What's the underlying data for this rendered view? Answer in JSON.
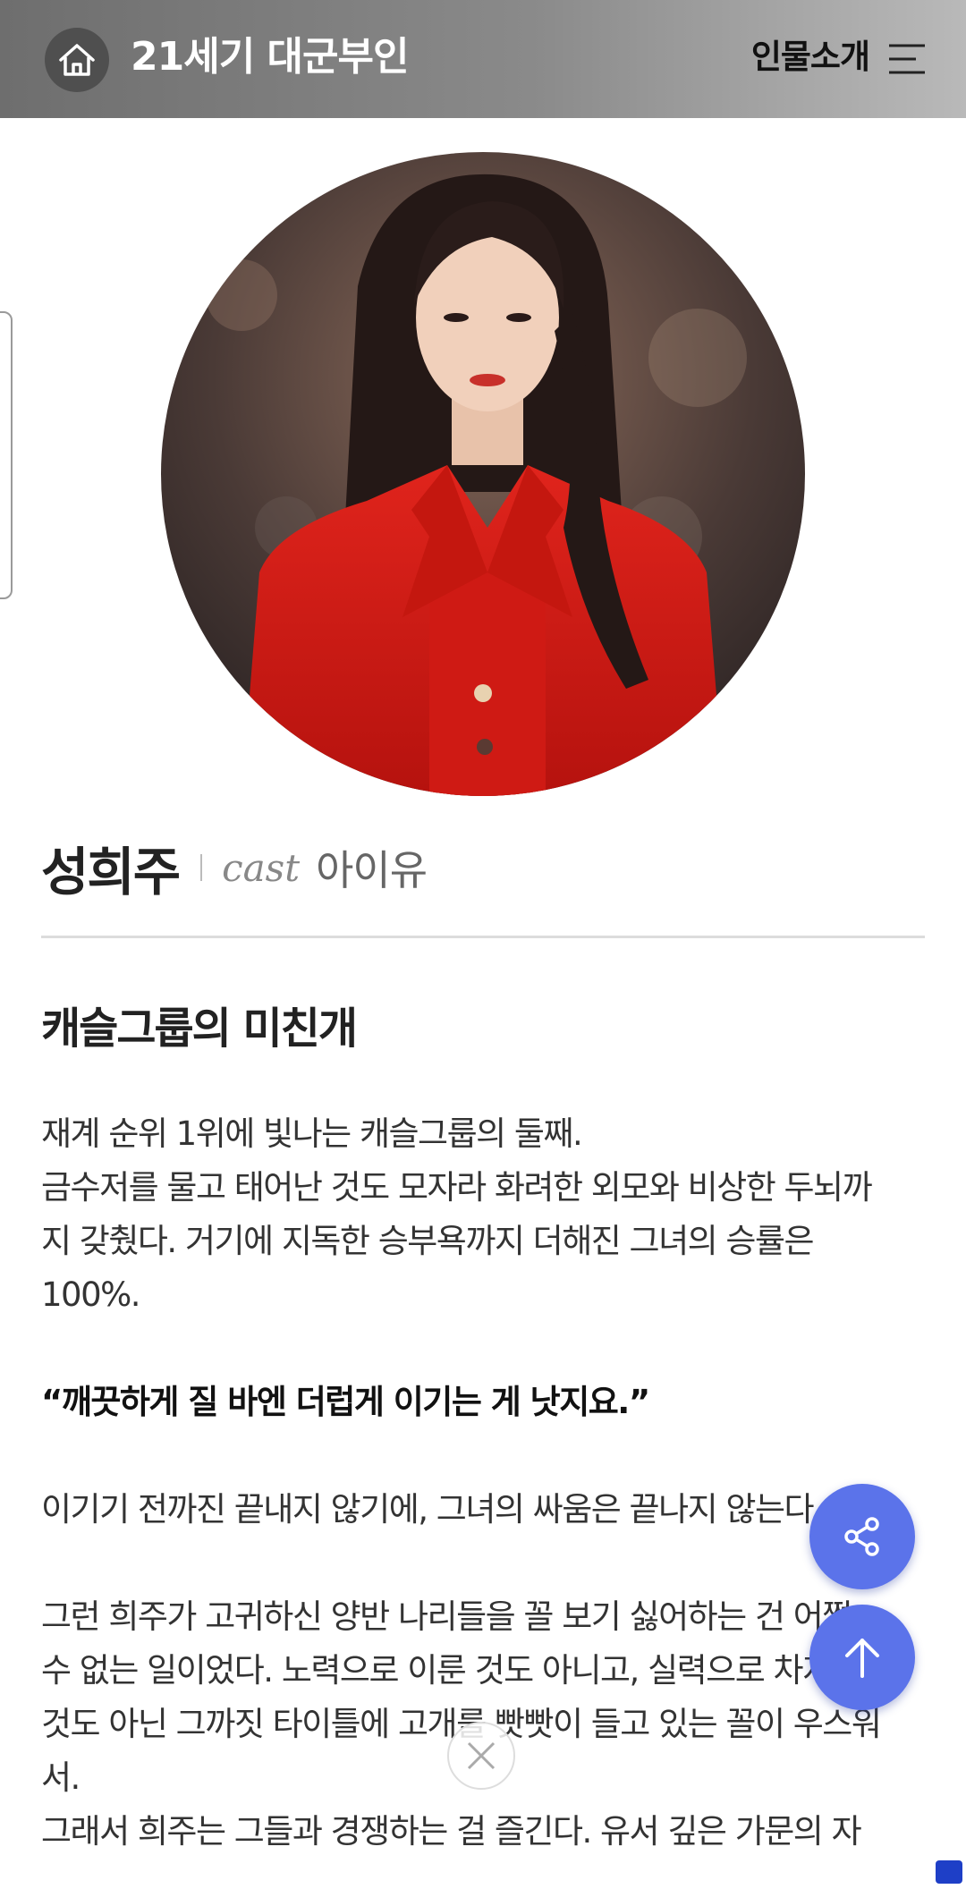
{
  "header": {
    "title": "21세기 대군부인",
    "menu_label": "인물소개",
    "home_icon": "home-icon",
    "menu_icon": "hamburger-menu-icon"
  },
  "profile": {
    "name": "성희주",
    "cast_label": "cast",
    "actor": "아이유"
  },
  "section": {
    "title": "캐슬그룹의 미친개"
  },
  "body": {
    "p1_l1": "재계 순위 1위에 빛나는 캐슬그룹의 둘째.",
    "p1_l2": "금수저를 물고 태어난 것도 모자라 화려한 외모와 비상한 두뇌까",
    "p1_l3": "지 갖췄다. 거기에 지독한 승부욕까지 더해진 그녀의 승률은",
    "p1_l4": "100%.",
    "quote": "“깨끗하게 질 바엔 더럽게 이기는 게 낫지요.”",
    "p2": "이기기 전까진 끝내지 않기에, 그녀의 싸움은 끝나지 않는다.",
    "p3_l1": "그런 희주가 고귀하신 양반 나리들을 꼴 보기 싫어하는 건 어쩔",
    "p3_l2": "수 없는 일이었다. 노력으로 이룬 것도 아니고, 실력으로 차지한",
    "p3_l3": "것도 아닌 그까짓 타이틀에 고개를 빳빳이 들고 있는 꼴이 우스워",
    "p3_l4": "서.",
    "p4_l1": "그래서 희주는 그들과 경쟁하는 걸 즐긴다. 유서 깊은 가문의 자"
  },
  "buttons": {
    "share_icon": "share-icon",
    "top_icon": "arrow-up-icon",
    "close_icon": "close-icon"
  },
  "colors": {
    "header_gradient_start": "#6e6e6e",
    "header_gradient_end": "#b9b9b9",
    "fab": "#5b73ea",
    "text": "#333333"
  }
}
